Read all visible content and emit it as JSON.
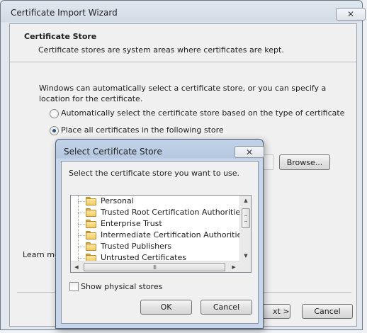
{
  "wizard": {
    "title": "Certificate Import Wizard",
    "close_label": "✕",
    "header_title": "Certificate Store",
    "header_desc": "Certificate stores are system areas where certificates are kept.",
    "body_text": "Windows can automatically select a certificate store, or you can specify a location for the certificate.",
    "radio_auto_label": "Automatically select the certificate store based on the type of certificate",
    "radio_place_label": "Place all certificates in the following store",
    "selected_option": "place",
    "browse_label": "Browse...",
    "learn_more_label": "Learn mor",
    "next_label": "xt >",
    "cancel_label": "Cancel"
  },
  "dialog": {
    "title": "Select Certificate Store",
    "close_label": "✕",
    "prompt": "Select the certificate store you want to use.",
    "stores": [
      "Personal",
      "Trusted Root Certification Authorities",
      "Enterprise Trust",
      "Intermediate Certification Authorities",
      "Trusted Publishers",
      "Untrusted Certificates"
    ],
    "scroll_up": "▲",
    "scroll_down": "▼",
    "scroll_left": "◀",
    "scroll_right": "▶",
    "hscroll_grip": "III",
    "show_physical_label": "Show physical stores",
    "show_physical_checked": false,
    "ok_label": "OK",
    "cancel_label": "Cancel"
  },
  "colors": {
    "title_bar_active": "#b5c8e0",
    "title_bar_inactive": "#d3dce6",
    "folder_icon": "#f1cc64",
    "radio_selected": "#2a4f8f"
  }
}
